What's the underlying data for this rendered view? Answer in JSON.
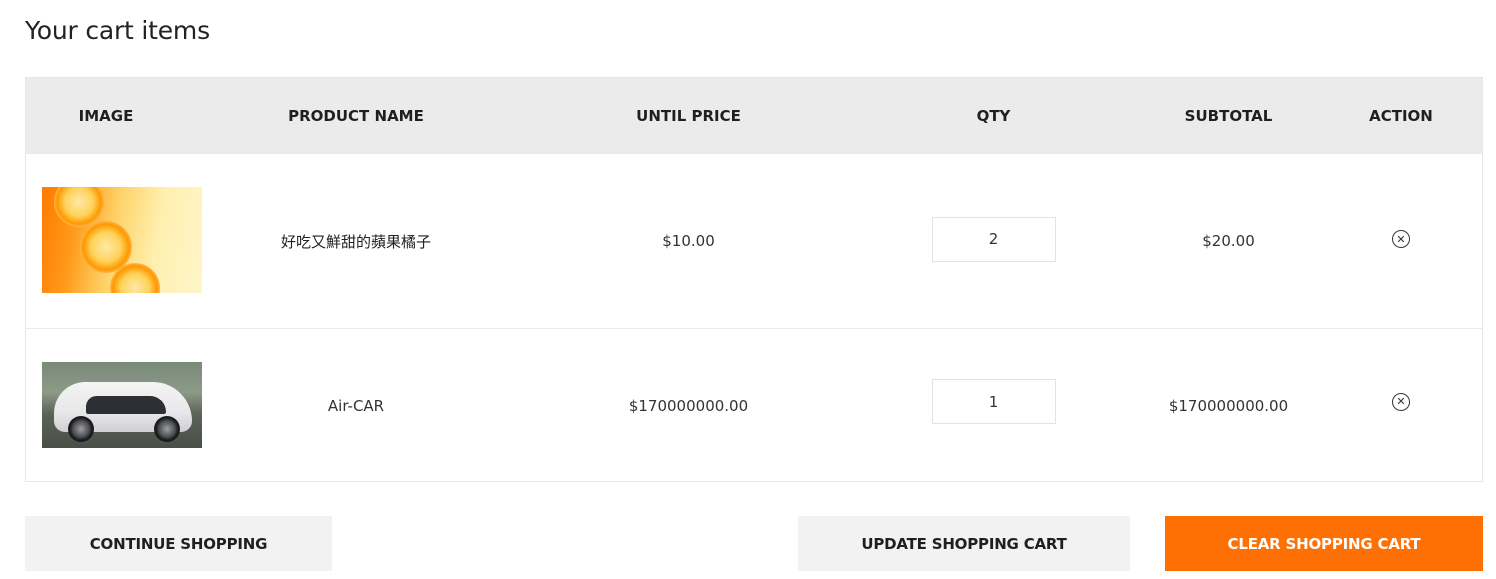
{
  "page": {
    "title": "Your cart items"
  },
  "table": {
    "headers": [
      "Image",
      "Product Name",
      "Until Price",
      "Qty",
      "Subtotal",
      "Action"
    ],
    "rows": [
      {
        "image_icon": "orange-slices-image",
        "name": "好吃又鮮甜的蘋果橘子",
        "price": "$10.00",
        "qty": "2",
        "subtotal": "$20.00",
        "action_icon": "remove-circle-icon",
        "action_symbol": "✕"
      },
      {
        "image_icon": "white-car-image",
        "name": "Air-CAR",
        "price": "$170000000.00",
        "qty": "1",
        "subtotal": "$170000000.00",
        "action_icon": "remove-circle-icon",
        "action_symbol": "✕"
      }
    ]
  },
  "actions": {
    "continue_label": "Continue Shopping",
    "update_label": "Update Shopping Cart",
    "clear_label": "Clear Shopping Cart"
  },
  "colors": {
    "accent": "#ff7004",
    "header_bg": "#ebebeb",
    "secondary_button_bg": "#f2f2f2"
  }
}
